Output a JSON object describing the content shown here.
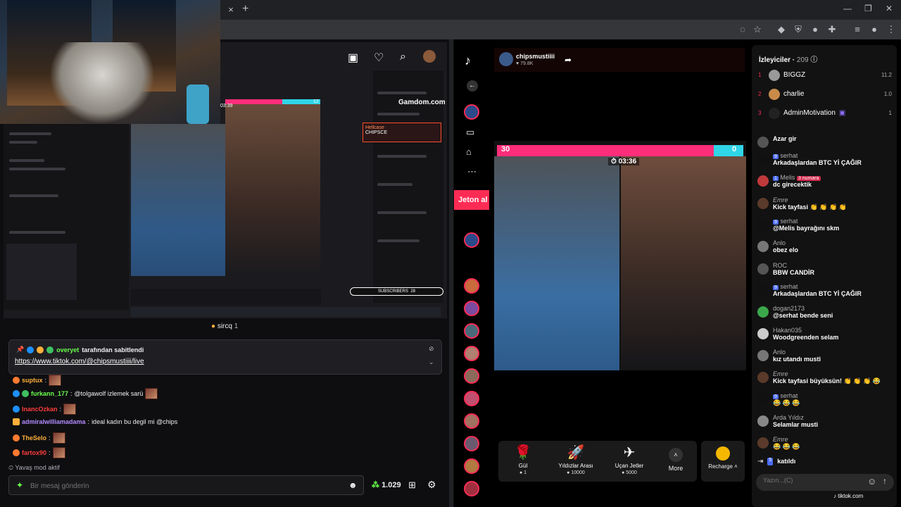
{
  "browser": {
    "tab_close": "×",
    "new_tab": "+"
  },
  "twitch": {
    "viewer_name": "sircq",
    "viewer_count": "1",
    "pinned": {
      "by_user": "overyet",
      "by_text": "tarafından sabitlendi",
      "link": "https://www.tiktok.com/@chipsmustiiii/live"
    },
    "messages": [
      {
        "user": "suptux",
        "color": "#ffb03a",
        "text": ""
      },
      {
        "user": "furkann_177",
        "color": "#6bff4e",
        "text": "@tolgawolf izlemek sarü"
      },
      {
        "user": "InancOzkan",
        "color": "#ff3b3b",
        "text": ""
      },
      {
        "user": "admiralwilliamadama",
        "color": "#b28cff",
        "text": "ideal kadın bu degil mi @chips"
      },
      {
        "user": "TheSelo",
        "color": "#ffb03a",
        "text": ""
      },
      {
        "user": "fartox90",
        "color": "#ff3b3b",
        "text": ""
      }
    ],
    "slow_mode": "Yavaş mod aktif",
    "input_placeholder": "Bir mesaj gönderin",
    "points": "1.029",
    "stream_overlay": {
      "gamdom": "Gamdom.com",
      "hellcase": "Hellcase",
      "chipsce": "CHIPSCE",
      "subscribers": "SUBSCRIBERS",
      "subs_count": "28",
      "timer": "03:39",
      "score_right": "12"
    }
  },
  "tiktok": {
    "host_name": "chipsmustiiii",
    "host_likes": "79.8K",
    "jeton": "Jeton al",
    "battle": {
      "left_score": "30",
      "right_score": "0",
      "timer": "03:36"
    },
    "gifts": [
      {
        "name": "Gül",
        "price": "1",
        "icon": "🌹"
      },
      {
        "name": "Yıldızlar Arası",
        "price": "10000",
        "icon": "🚀"
      },
      {
        "name": "Uçan Jetler",
        "price": "5000",
        "icon": "✈"
      }
    ],
    "more_label": "More",
    "recharge_label": "Recharge",
    "viewers_title": "İzleyiciler",
    "viewers_count": "209",
    "top_viewers": [
      {
        "rank": "1",
        "name": "BIGGZ",
        "score": "11.2"
      },
      {
        "rank": "2",
        "name": "charlie",
        "score": "1.0"
      },
      {
        "rank": "3",
        "name": "AdminMotivation",
        "score": "1"
      }
    ],
    "chat": [
      {
        "name": "",
        "lvl": "",
        "text": "Azar gir"
      },
      {
        "name": "serhat",
        "lvl": "9",
        "text": "Arkadaşlardan BTC Yİ ÇAĞIR"
      },
      {
        "name": "Melis",
        "lvl": "1",
        "badge": "3 numara",
        "text": "dc girecektik"
      },
      {
        "name": "Emre",
        "lvl": "",
        "text": "Kick tayfasi 👏 👏 👏 👏"
      },
      {
        "name": "serhat",
        "lvl": "9",
        "text": "@Melis bayrağını skm"
      },
      {
        "name": "Anlo",
        "lvl": "",
        "text": "obez elo"
      },
      {
        "name": "ROC",
        "lvl": "",
        "text": "BBW CANDİR"
      },
      {
        "name": "serhat",
        "lvl": "9",
        "text": "Arkadaşlardan BTC Yİ ÇAĞIR"
      },
      {
        "name": "dogan2173",
        "lvl": "",
        "text": "@serhat bende seni"
      },
      {
        "name": "Hakan035",
        "lvl": "",
        "text": "Woodgreenden selam"
      },
      {
        "name": "Anlo",
        "lvl": "",
        "text": "kız utandı musti"
      },
      {
        "name": "Emre",
        "lvl": "",
        "text": "Kick tayfasi büyüksün! 👏 👏 👏 😂"
      },
      {
        "name": "serhat",
        "lvl": "9",
        "text": "😂 😂 😂"
      },
      {
        "name": "Arda Yıldız",
        "lvl": "",
        "text": "Selamlar musti"
      },
      {
        "name": "Emre",
        "lvl": "",
        "text": "😂 😂 😂"
      }
    ],
    "joined": {
      "lvl": "5",
      "text": "katıldı"
    },
    "input_placeholder": "Yazın...(C)",
    "status_url": "tiktok.com"
  }
}
